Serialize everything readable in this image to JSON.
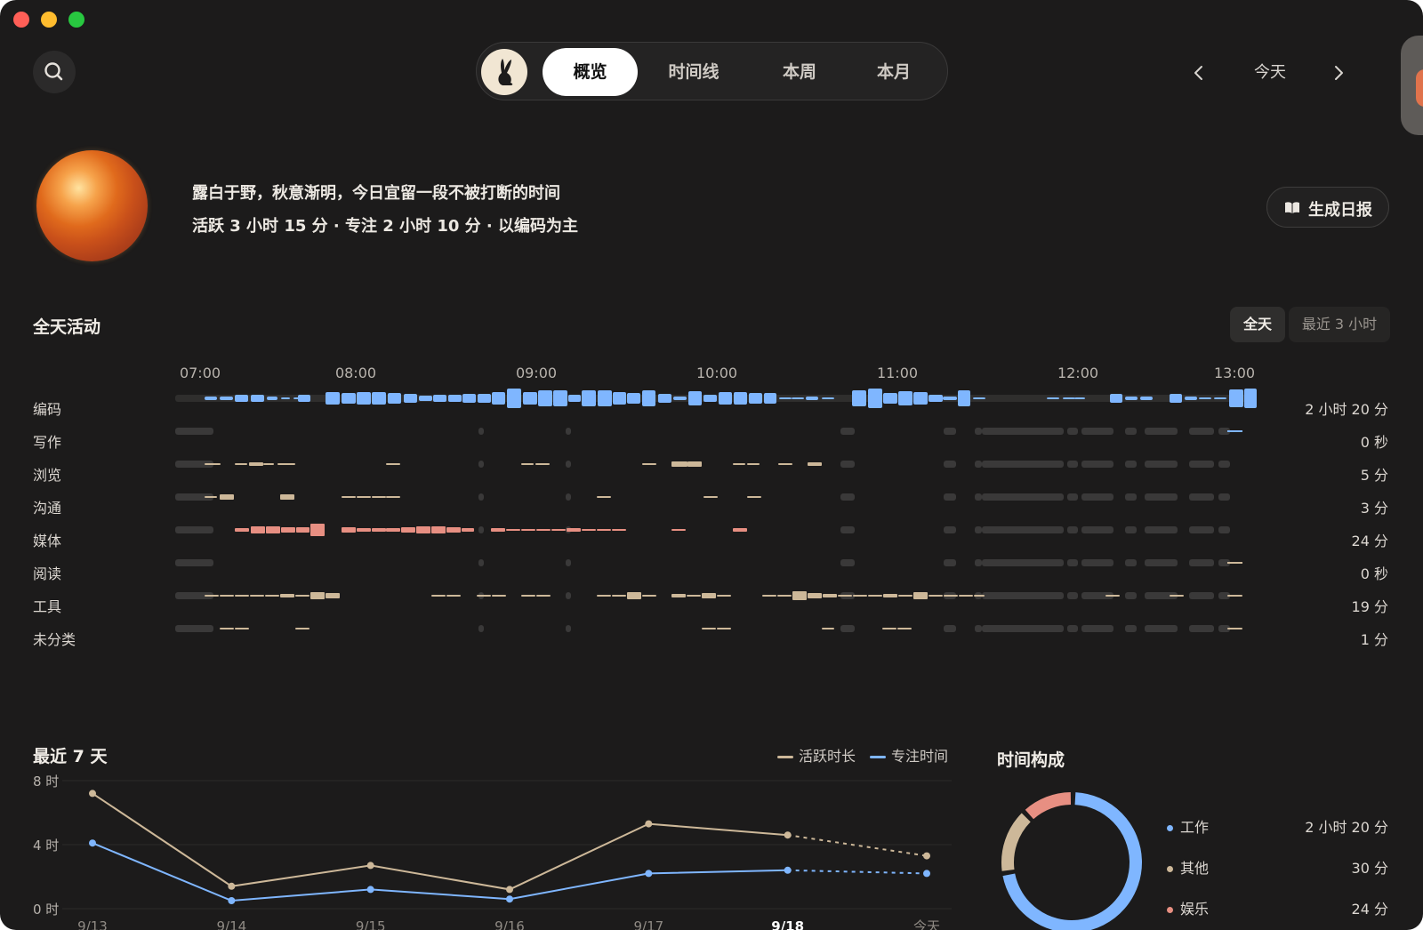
{
  "colors": {
    "background": "#1c1b1b",
    "work": "#7fb6ff",
    "other": "#cdb899",
    "entertainment": "#e78f82",
    "idle": "#3a3939"
  },
  "toolbar": {
    "search_icon": "search-icon",
    "tabs": [
      "概览",
      "时间线",
      "本周",
      "本月"
    ],
    "active_tab": "概览",
    "date_label": "今天",
    "prev_icon": "chevron-left-icon",
    "next_icon": "chevron-right-icon"
  },
  "hero": {
    "line1": "露白于野，秋意渐明，今日宜留一段不被打断的时间",
    "line2": "活跃 3 小时 15 分 · 专注 2 小时 10 分 · 以编码为主",
    "report_button": "生成日报"
  },
  "activity": {
    "title": "全天活动",
    "range_options": [
      "全天",
      "最近 3 小时"
    ],
    "active_range": "全天",
    "hours": [
      "07:00",
      "08:00",
      "09:00",
      "10:00",
      "11:00",
      "12:00",
      "13:00"
    ],
    "rows": [
      {
        "label": "编码",
        "total": "2 小时 20 分"
      },
      {
        "label": "写作",
        "total": "0 秒"
      },
      {
        "label": "浏览",
        "total": "5 分"
      },
      {
        "label": "沟通",
        "total": "3 分"
      },
      {
        "label": "媒体",
        "total": "24 分"
      },
      {
        "label": "阅读",
        "total": "0 秒"
      },
      {
        "label": "工具",
        "total": "19 分"
      },
      {
        "label": "未分类",
        "total": "1 分"
      }
    ]
  },
  "week": {
    "title": "最近 7 天",
    "legend": [
      "活跃时长",
      "专注时间"
    ]
  },
  "chart_data": {
    "type": "line",
    "categories": [
      "9/13",
      "9/14",
      "9/15",
      "9/16",
      "9/17",
      "9/18",
      "今天"
    ],
    "highlight_category": "9/18",
    "y_ticks": [
      "8 时",
      "4 时",
      "0 时"
    ],
    "ylim": [
      0,
      8
    ],
    "series": [
      {
        "name": "活跃时长",
        "values": [
          7.2,
          1.4,
          2.7,
          1.2,
          5.3,
          4.6,
          3.3
        ]
      },
      {
        "name": "专注时间",
        "values": [
          4.1,
          0.5,
          1.2,
          0.6,
          2.2,
          2.4,
          2.2
        ]
      }
    ],
    "dashed_segment_from": "9/18"
  },
  "composition": {
    "title": "时间构成",
    "items": [
      {
        "label": "工作",
        "value": "2 小时 20 分"
      },
      {
        "label": "其他",
        "value": "30 分"
      },
      {
        "label": "娱乐",
        "value": "24 分"
      }
    ],
    "minutes": [
      140,
      30,
      24
    ]
  }
}
